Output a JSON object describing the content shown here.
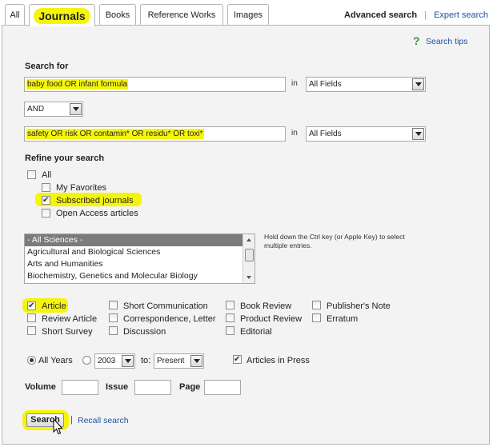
{
  "tabs": [
    {
      "label": "All"
    },
    {
      "label": "Journals",
      "active": true
    },
    {
      "label": "Books"
    },
    {
      "label": "Reference Works"
    },
    {
      "label": "Images"
    }
  ],
  "header": {
    "advanced_search": "Advanced search",
    "separator": "|",
    "expert_search": "Expert search",
    "search_tips": "Search tips"
  },
  "search_for": {
    "label": "Search for",
    "query1": "baby food OR infant formula",
    "in_label": "in",
    "field1": "All Fields",
    "operator": "AND",
    "query2": "safety OR risk OR contamin* OR residu* OR toxi*",
    "field2": "All Fields"
  },
  "refine": {
    "label": "Refine your search",
    "all": "All",
    "my_favorites": "My Favorites",
    "subscribed": "Subscribed journals",
    "open_access": "Open Access articles",
    "subject_options": [
      "- All Sciences -",
      "Agricultural and Biological Sciences",
      "Arts and Humanities",
      "Biochemistry, Genetics and Molecular Biology"
    ],
    "hint": "Hold down the Ctrl key (or Apple Key) to select multiple entries."
  },
  "doc_types": {
    "article": "Article",
    "short_communication": "Short Communication",
    "book_review": "Book Review",
    "publishers_note": "Publisher's Note",
    "review_article": "Review Article",
    "correspondence": "Correspondence, Letter",
    "product_review": "Product Review",
    "erratum": "Erratum",
    "short_survey": "Short Survey",
    "discussion": "Discussion",
    "editorial": "Editorial"
  },
  "years": {
    "all_years": "All Years",
    "from": "2003",
    "to_label": "to:",
    "to": "Present",
    "articles_in_press": "Articles in Press"
  },
  "citation": {
    "volume": "Volume",
    "issue": "Issue",
    "page": "Page"
  },
  "actions": {
    "search": "Search",
    "separator": "|",
    "recall": "Recall search"
  },
  "colors": {
    "highlight": "#f5f50a",
    "link": "#1f53a3",
    "panel": "#f3f3f3"
  }
}
